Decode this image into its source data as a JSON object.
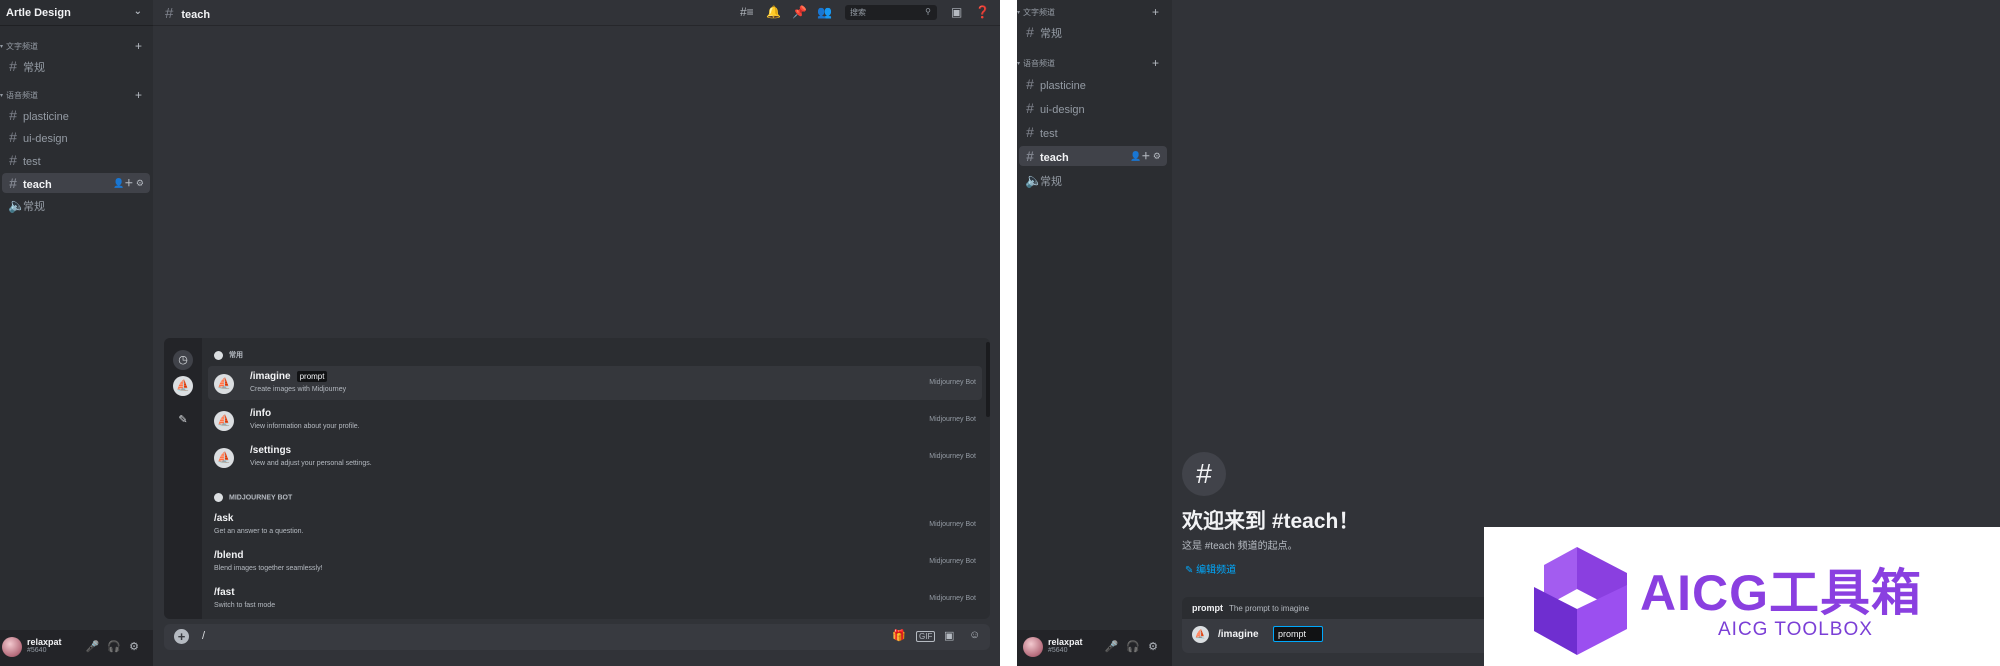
{
  "left": {
    "server_name": "Artle Design",
    "categories": [
      {
        "label": "文字频道"
      },
      {
        "label": "语音频道"
      }
    ],
    "channels": [
      {
        "label": "常规"
      },
      {
        "label": "plasticine"
      },
      {
        "label": "ui-design"
      },
      {
        "label": "test"
      },
      {
        "label": "teach"
      },
      {
        "label": "常规"
      }
    ],
    "user": {
      "name": "relaxpat",
      "tag": "#5640"
    },
    "topbar": {
      "channel": "teach",
      "search_placeholder": "搜索"
    },
    "autocomplete": {
      "section_frequent": "常用",
      "section_bot": "MIDJOURNEY BOT",
      "source": "Midjourney Bot",
      "items": [
        {
          "name": "/imagine",
          "param": "prompt",
          "desc": "Create images with Midjourney"
        },
        {
          "name": "/info",
          "desc": "View information about your profile."
        },
        {
          "name": "/settings",
          "desc": "View and adjust your personal settings."
        },
        {
          "name": "/ask",
          "desc": "Get an answer to a question."
        },
        {
          "name": "/blend",
          "desc": "Blend images together seamlessly!"
        },
        {
          "name": "/fast",
          "desc": "Switch to fast mode"
        }
      ]
    },
    "input_value": "/"
  },
  "right": {
    "categories": [
      {
        "label": "文字频道"
      },
      {
        "label": "语音频道"
      }
    ],
    "channels": [
      {
        "label": "常规"
      },
      {
        "label": "plasticine"
      },
      {
        "label": "ui-design"
      },
      {
        "label": "test"
      },
      {
        "label": "teach"
      },
      {
        "label": "常规"
      }
    ],
    "user": {
      "name": "relaxpat",
      "tag": "#5640"
    },
    "welcome_title": "欢迎来到 #teach！",
    "welcome_sub": "这是 #teach 频道的起点。",
    "edit_channel": "编辑频道",
    "prompt_label": "prompt",
    "prompt_desc": "The prompt to imagine",
    "prompt_command": "/imagine",
    "prompt_param": "prompt"
  },
  "watermark": {
    "title": "AICG工具箱",
    "subtitle": "AICG TOOLBOX"
  },
  "colors": {
    "bg": "#313338",
    "sidebar": "#2b2d31",
    "accent": "#00a8fc",
    "brand_purple": "#8a3fe0"
  }
}
